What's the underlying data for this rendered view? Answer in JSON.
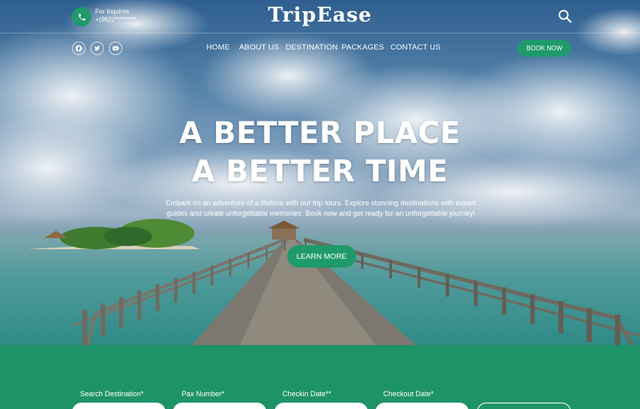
{
  "brand": {
    "logo": "TripEase",
    "accent": "#1f9a6b",
    "strip_color": "#1f9368"
  },
  "contact": {
    "label": "For Inquires :",
    "phone": "+(962)*********",
    "icon": "phone-icon"
  },
  "social": [
    {
      "name": "facebook-icon"
    },
    {
      "name": "twitter-icon"
    },
    {
      "name": "youtube-icon"
    }
  ],
  "nav": {
    "items": [
      {
        "label": "HOME"
      },
      {
        "label": "ABOUT US"
      },
      {
        "label": "DESTINATION"
      },
      {
        "label": "PACKAGES"
      },
      {
        "label": "CONTACT US"
      }
    ],
    "book_label": "BOOK NOW"
  },
  "hero": {
    "line1": "A BETTER PLACE",
    "line2": "A BETTER TIME",
    "description": "Embark on an adventure of a lifetime with our trip tours. Explore stunning destinations with expert guides and create unforgettable memories. Book now and get ready for an unforgettable journey!",
    "cta": "LEARN MORE"
  },
  "booking": {
    "fields": [
      {
        "label": "Search Destination*",
        "value": ""
      },
      {
        "label": "Pax Number*",
        "value": ""
      },
      {
        "label": "Checkin Date**",
        "value": ""
      },
      {
        "label": "Checkout Date*",
        "value": ""
      }
    ]
  }
}
